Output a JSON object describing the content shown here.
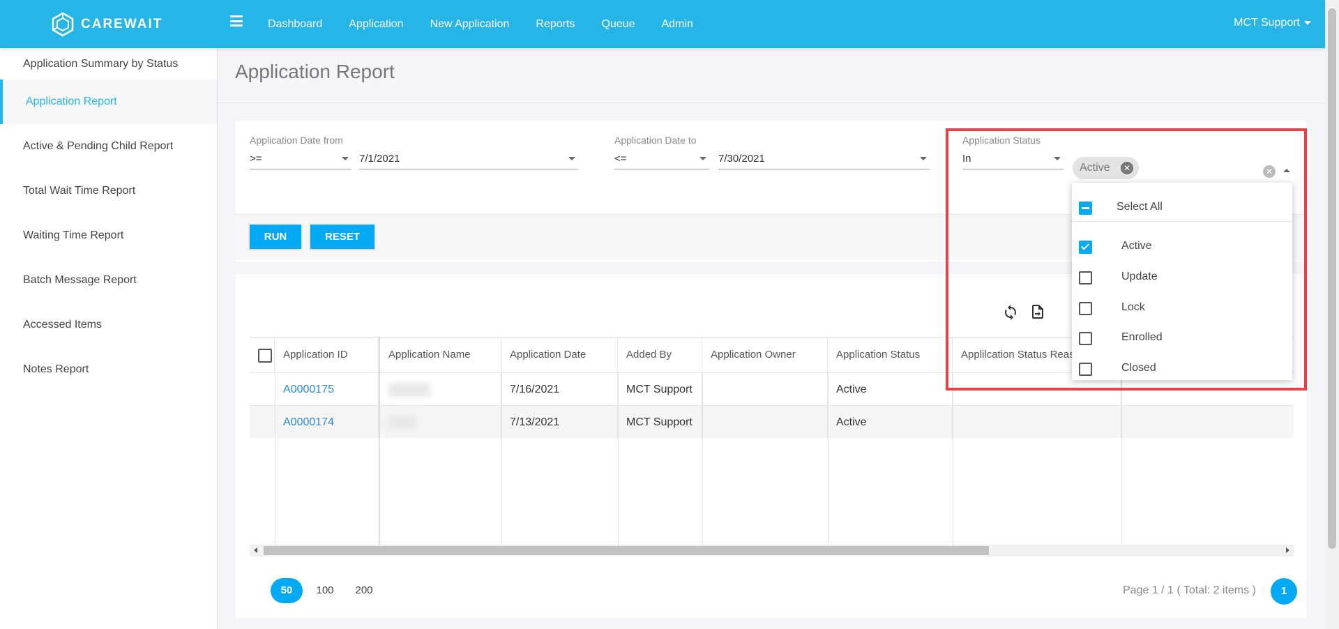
{
  "app": {
    "brand": "CAREWAIT"
  },
  "nav": {
    "items": [
      "Dashboard",
      "Application",
      "New Application",
      "Reports",
      "Queue",
      "Admin"
    ],
    "user": "MCT Support"
  },
  "sidebar": {
    "items": [
      "Application Summary by Status",
      "Application Report",
      "Active & Pending Child Report",
      "Total Wait Time Report",
      "Waiting Time Report",
      "Batch Message Report",
      "Accessed Items",
      "Notes Report"
    ]
  },
  "page": {
    "title": "Application Report"
  },
  "filters": {
    "date_from": {
      "label": "Application Date from",
      "operator": ">=",
      "value": "7/1/2021"
    },
    "date_to": {
      "label": "Application Date to",
      "operator": "<=",
      "value": "7/30/2021"
    },
    "status": {
      "label": "Application Status",
      "operator": "In",
      "chip": "Active"
    },
    "run_label": "RUN",
    "reset_label": "RESET"
  },
  "status_dropdown": {
    "select_all": "Select All",
    "options": [
      {
        "label": "Active",
        "checked": true
      },
      {
        "label": "Update",
        "checked": false
      },
      {
        "label": "Lock",
        "checked": false
      },
      {
        "label": "Enrolled",
        "checked": false
      },
      {
        "label": "Closed",
        "checked": false
      }
    ]
  },
  "grid": {
    "columns": [
      "Application ID",
      "Application Name",
      "Application Date",
      "Added By",
      "Application Owner",
      "Application Status",
      "Applilcation Status Reason"
    ],
    "rows": [
      {
        "id": "A0000175",
        "date": "7/16/2021",
        "added_by": "MCT Support",
        "owner": "",
        "status": "Active"
      },
      {
        "id": "A0000174",
        "date": "7/13/2021",
        "added_by": "MCT Support",
        "owner": "",
        "status": "Active"
      }
    ]
  },
  "pagination": {
    "sizes": [
      "50",
      "100",
      "200"
    ],
    "info": "Page 1 / 1 ( Total: 2 items )",
    "current": "1"
  },
  "colors": {
    "accent": "#25b5e6",
    "button": "#03a9f4",
    "highlight": "#e8414a",
    "link": "#2a8ad6"
  }
}
